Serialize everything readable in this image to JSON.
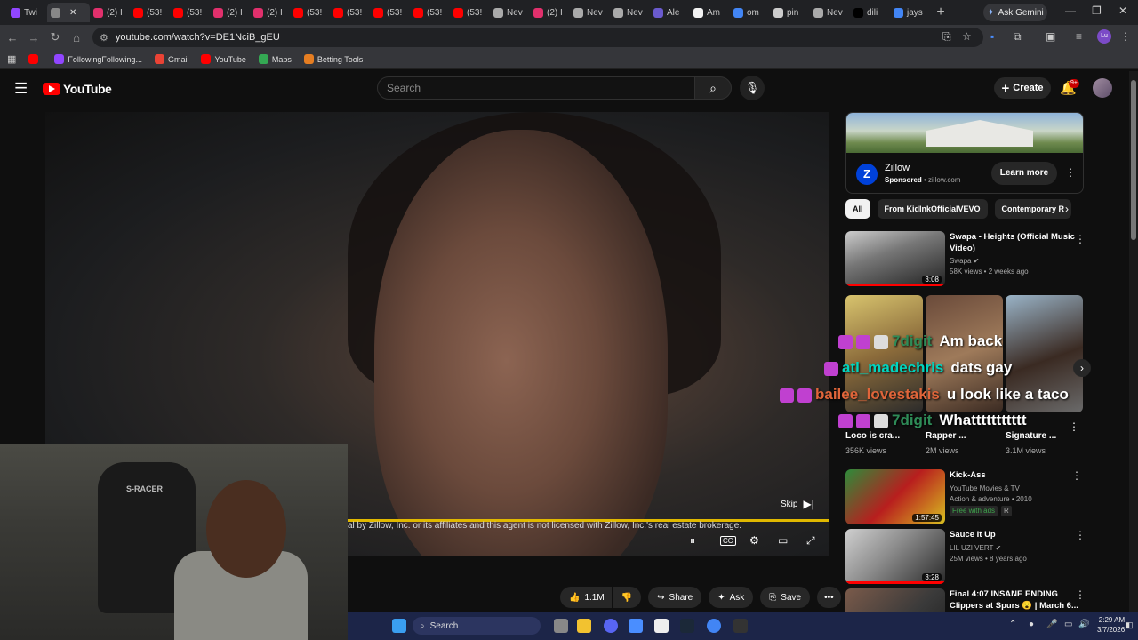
{
  "browser": {
    "tabs": [
      {
        "label": "Twi",
        "icon": "twitch-icon",
        "color": "#9146ff"
      },
      {
        "label": "",
        "icon": "audio-icon",
        "color": "#888888",
        "active": true
      },
      {
        "label": "(2) I",
        "icon": "instagram-icon",
        "color": "#e1306c"
      },
      {
        "label": "(53!",
        "icon": "youtube-icon",
        "color": "#ff0000"
      },
      {
        "label": "(53!",
        "icon": "youtube-icon",
        "color": "#ff0000"
      },
      {
        "label": "(2) I",
        "icon": "instagram-icon",
        "color": "#e1306c"
      },
      {
        "label": "(2) I",
        "icon": "instagram-icon",
        "color": "#e1306c"
      },
      {
        "label": "(53!",
        "icon": "youtube-icon",
        "color": "#ff0000"
      },
      {
        "label": "(53!",
        "icon": "youtube-icon",
        "color": "#ff0000"
      },
      {
        "label": "(53!",
        "icon": "youtube-icon",
        "color": "#ff0000"
      },
      {
        "label": "(53!",
        "icon": "youtube-icon",
        "color": "#ff0000"
      },
      {
        "label": "(53!",
        "icon": "youtube-icon",
        "color": "#ff0000"
      },
      {
        "label": "Nev",
        "icon": "globe-icon",
        "color": "#aaaaaa"
      },
      {
        "label": "(2) I",
        "icon": "instagram-icon",
        "color": "#e1306c"
      },
      {
        "label": "Nev",
        "icon": "globe-icon",
        "color": "#aaaaaa"
      },
      {
        "label": "Nev",
        "icon": "globe-icon",
        "color": "#aaaaaa"
      },
      {
        "label": "Ale",
        "icon": "alert-icon",
        "color": "#6a5acd"
      },
      {
        "label": "Am",
        "icon": "amazon-icon",
        "color": "#f2f2f2"
      },
      {
        "label": "om",
        "icon": "google-icon",
        "color": "#4285f4"
      },
      {
        "label": "pin",
        "icon": "pin-icon",
        "color": "#cccccc"
      },
      {
        "label": "Nev",
        "icon": "globe-icon",
        "color": "#aaaaaa"
      },
      {
        "label": "dili",
        "icon": "x-icon",
        "color": "#000000"
      },
      {
        "label": "jays",
        "icon": "google-icon",
        "color": "#4285f4"
      }
    ],
    "ask_gemini": "Ask Gemini",
    "url": "youtube.com/watch?v=DE1NciB_gEU",
    "profile_initials": "Lu",
    "bookmarks": [
      {
        "label": "",
        "icon": "youtube-icon",
        "color": "#ff0000"
      },
      {
        "label": "FollowingFollowing...",
        "icon": "twitch-icon",
        "color": "#9146ff"
      },
      {
        "label": "Gmail",
        "icon": "gmail-icon",
        "color": "#ea4335"
      },
      {
        "label": "YouTube",
        "icon": "youtube-icon",
        "color": "#ff0000"
      },
      {
        "label": "Maps",
        "icon": "maps-icon",
        "color": "#34a853"
      },
      {
        "label": "Betting Tools",
        "icon": "betting-icon",
        "color": "#e67e22"
      }
    ]
  },
  "youtube": {
    "logo_text": "YouTube",
    "search_placeholder": "Search",
    "create_label": "Create",
    "notif_count": "9+"
  },
  "player": {
    "caption": "al by Zillow, Inc. or its affiliates and this agent is not licensed with Zillow, Inc.'s real estate brokerage.",
    "skip_label": "Skip"
  },
  "webcam": {
    "chair_brand": "S-RACER"
  },
  "actions": {
    "likes": "1.1M",
    "share": "Share",
    "ask": "Ask",
    "save": "Save"
  },
  "ad": {
    "name": "Zillow",
    "sponsored": "Sponsored",
    "domain": "zillow.com",
    "cta": "Learn more"
  },
  "chips": [
    "All",
    "From KidInkOfficialVEVO",
    "Contemporary R"
  ],
  "recs": [
    {
      "title": "Swapa - Heights (Official Music Video)",
      "channel": "Swapa",
      "meta": "58K views • 2 weeks ago",
      "duration": "3:08"
    },
    {
      "title": "Kick-Ass",
      "channel": "YouTube Movies & TV",
      "meta": "Action & adventure • 2010",
      "free": "Free with ads",
      "rating": "R",
      "duration": "1:57:45"
    },
    {
      "title": "Sauce It Up",
      "channel": "LIL UZI VERT",
      "meta": "25M views • 8 years ago",
      "duration": "3:28"
    },
    {
      "title": "Final 4:07 INSANE ENDING Clippers at Spurs 😮 | March 6...",
      "channel": "",
      "meta": "",
      "duration": ""
    }
  ],
  "shorts": [
    {
      "title": "Loco is cra...",
      "views": "356K views"
    },
    {
      "title": "Rapper ...",
      "views": "2M views"
    },
    {
      "title": "Signature ...",
      "views": "3.1M views"
    }
  ],
  "chat": [
    {
      "user": "7digit",
      "msg": "Am back",
      "color": "#2e8b57"
    },
    {
      "user": "atl_madechris",
      "msg": "dats gay",
      "color": "#00d5c0"
    },
    {
      "user": "bailee_lovestakis",
      "msg": "u look like a taco",
      "color": "#e0653a"
    },
    {
      "user": "7digit",
      "msg": "Whattttttttttt",
      "color": "#2e8b57"
    }
  ],
  "taskbar": {
    "search": "Search",
    "time": "2:29 AM",
    "date": "3/7/2026"
  }
}
